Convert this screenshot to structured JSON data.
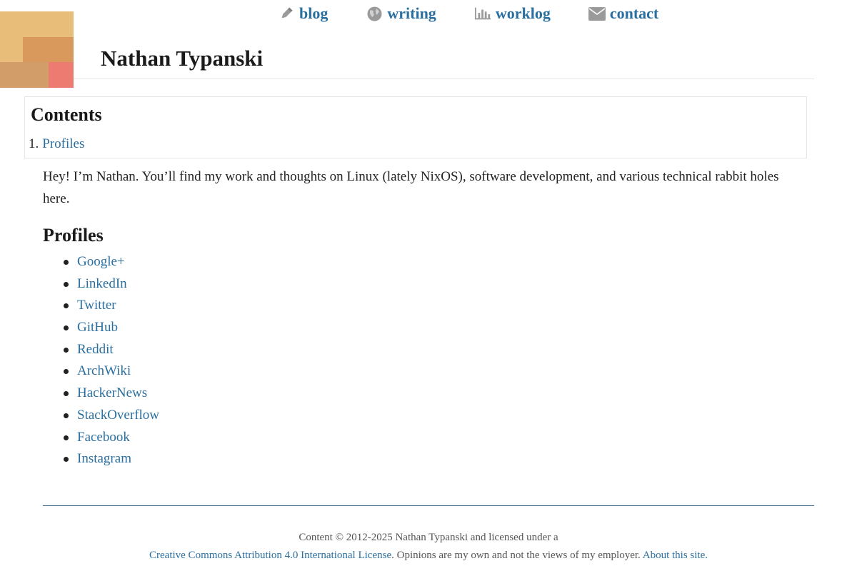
{
  "nav": {
    "items": [
      {
        "label": "blog",
        "icon": "pencil-icon"
      },
      {
        "label": "writing",
        "icon": "globe-icon"
      },
      {
        "label": "worklog",
        "icon": "bar-chart-icon"
      },
      {
        "label": "contact",
        "icon": "envelope-icon"
      }
    ]
  },
  "site": {
    "title": "Nathan Typanski"
  },
  "toc": {
    "title": "Contents",
    "items": [
      {
        "number": "1.",
        "label": "Profiles"
      }
    ]
  },
  "main": {
    "intro": "Hey! I’m Nathan. You’ll find my work and thoughts on Linux (lately NixOS), software development, and various technical rabbit holes here.",
    "profiles_heading": "Profiles",
    "profiles": [
      "Google+",
      "LinkedIn",
      "Twitter",
      "GitHub",
      "Reddit",
      "ArchWiki",
      "HackerNews",
      "StackOverflow",
      "Facebook",
      "Instagram"
    ]
  },
  "footer": {
    "line1": "Content © 2012-2025 Nathan Typanski and licensed under a",
    "license_link": "Creative Commons Attribution 4.0 International License",
    "opinion_text": ". Opinions are my own and not the views of my employer. ",
    "about_link": "About this site."
  },
  "colors": {
    "link": "#2a6fa0",
    "icon": "#9a9a9a",
    "logo_base": "#e8bc79",
    "logo_mid": "#d9985c",
    "logo_accent": "#ee7b72"
  }
}
